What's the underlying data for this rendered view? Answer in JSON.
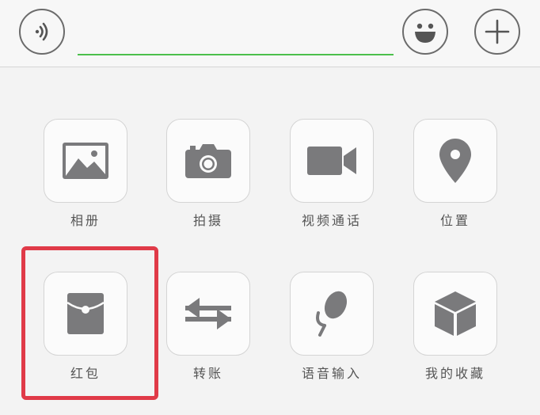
{
  "input_bar": {
    "voice_icon": "voice-icon",
    "emoji_icon": "emoji-icon",
    "plus_icon": "plus-icon",
    "input_value": "",
    "input_accent": "#4cc04c"
  },
  "panel": {
    "items": [
      {
        "label": "相册",
        "icon": "photo-album-icon"
      },
      {
        "label": "拍摄",
        "icon": "camera-icon"
      },
      {
        "label": "视频通话",
        "icon": "video-call-icon"
      },
      {
        "label": "位置",
        "icon": "location-icon"
      },
      {
        "label": "红包",
        "icon": "red-packet-icon"
      },
      {
        "label": "转账",
        "icon": "transfer-icon"
      },
      {
        "label": "语音输入",
        "icon": "microphone-icon"
      },
      {
        "label": "我的收藏",
        "icon": "favorites-icon"
      }
    ]
  },
  "highlight_color": "#e03a48",
  "icon_color": "#7a7a7c"
}
